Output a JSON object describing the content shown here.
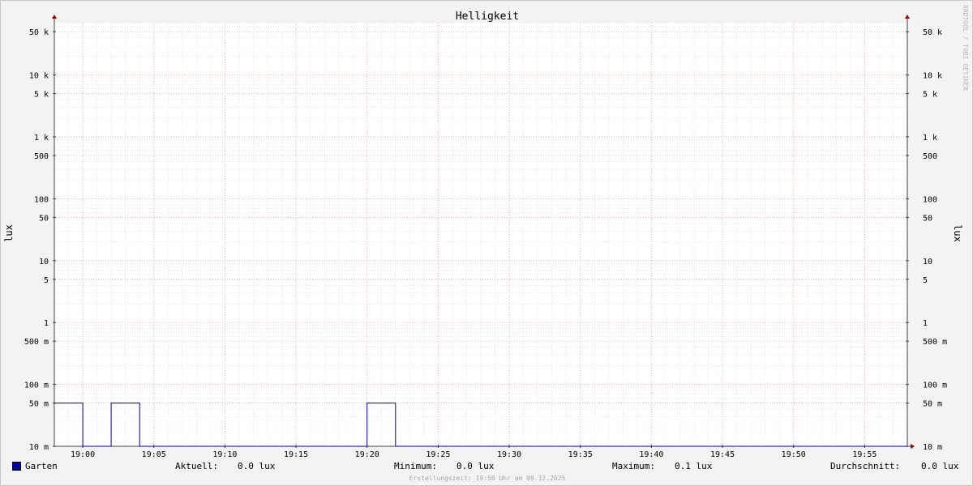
{
  "chart_data": {
    "type": "line",
    "title": "Helligkeit",
    "ylabel": "lux",
    "ylabel_right": "lux",
    "y_scale": "log",
    "ylim": [
      0.01,
      70000
    ],
    "x_time_range": [
      "18:58",
      "19:58"
    ],
    "x_ticks": [
      "19:00",
      "19:05",
      "19:10",
      "19:15",
      "19:20",
      "19:25",
      "19:30",
      "19:35",
      "19:40",
      "19:45",
      "19:50",
      "19:55"
    ],
    "y_ticks": [
      {
        "value": 50000,
        "label": "50 k"
      },
      {
        "value": 10000,
        "label": "10 k"
      },
      {
        "value": 5000,
        "label": "5 k"
      },
      {
        "value": 1000,
        "label": "1 k"
      },
      {
        "value": 500,
        "label": "500"
      },
      {
        "value": 100,
        "label": "100"
      },
      {
        "value": 50,
        "label": "50"
      },
      {
        "value": 10,
        "label": "10"
      },
      {
        "value": 5,
        "label": "5"
      },
      {
        "value": 1,
        "label": "1"
      },
      {
        "value": 0.5,
        "label": "500 m"
      },
      {
        "value": 0.1,
        "label": "100 m"
      },
      {
        "value": 0.05,
        "label": "50 m"
      },
      {
        "value": 0.01,
        "label": "10 m"
      }
    ],
    "grid": true,
    "series": [
      {
        "name": "Garten",
        "color": "#0000a0",
        "points": [
          [
            "18:58",
            0.05
          ],
          [
            "19:00",
            0.05
          ],
          [
            "19:00",
            0.01
          ],
          [
            "19:02",
            0.01
          ],
          [
            "19:02",
            0.05
          ],
          [
            "19:04",
            0.05
          ],
          [
            "19:04",
            0.01
          ],
          [
            "19:20",
            0.01
          ],
          [
            "19:20",
            0.05
          ],
          [
            "19:22",
            0.05
          ],
          [
            "19:22",
            0.01
          ],
          [
            "19:58",
            0.01
          ]
        ]
      }
    ]
  },
  "legend": {
    "series_name": "Garten",
    "aktuell_label": "Aktuell:",
    "aktuell_value": "0.0 lux",
    "minimum_label": "Minimum:",
    "minimum_value": "0.0 lux",
    "maximum_label": "Maximum:",
    "maximum_value": "0.1 lux",
    "durchschnitt_label": "Durchschnitt:",
    "durchschnitt_value": "0.0 lux"
  },
  "footer": "Erstellungszeit: 19:58 Uhr am 09.12.2025",
  "watermark": "RRDTOOL / TOBI OETIKER",
  "colors": {
    "grid_minor": "#d6d6d6",
    "grid_major": "#e8a0a0",
    "axis": "#404040",
    "arrow": "#a00000"
  }
}
